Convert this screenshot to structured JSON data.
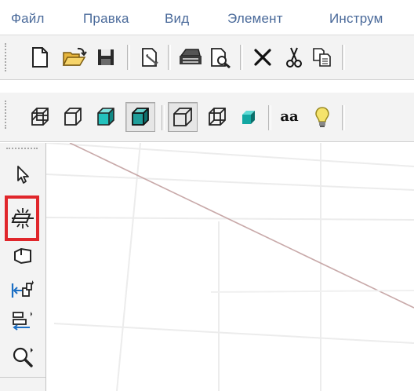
{
  "menu": {
    "items": [
      {
        "label": "Файл"
      },
      {
        "label": "Правка"
      },
      {
        "label": "Вид"
      },
      {
        "label": "Элемент"
      },
      {
        "label": "Инструм"
      }
    ]
  },
  "toolbar_main": {
    "buttons": [
      {
        "icon": "new-document-icon"
      },
      {
        "icon": "open-folder-icon"
      },
      {
        "icon": "save-icon"
      },
      {
        "icon": "properties-icon"
      },
      {
        "icon": "print-icon"
      },
      {
        "icon": "print-preview-icon"
      },
      {
        "icon": "delete-icon"
      },
      {
        "icon": "cut-icon"
      },
      {
        "icon": "copy-icon"
      }
    ]
  },
  "toolbar_view": {
    "buttons": [
      {
        "icon": "wireframe-icon",
        "pressed": false
      },
      {
        "icon": "hidden-lines-icon",
        "pressed": false
      },
      {
        "icon": "shaded-icon",
        "pressed": false
      },
      {
        "icon": "shaded-edges-icon",
        "pressed": true
      },
      {
        "icon": "perspective-icon",
        "pressed": true
      },
      {
        "icon": "wireframe-alt-icon",
        "pressed": false
      },
      {
        "icon": "solid-cube-icon",
        "pressed": false
      },
      {
        "icon": "font-size-icon",
        "label": "aa",
        "pressed": false
      },
      {
        "icon": "lightbulb-icon",
        "pressed": false
      }
    ]
  },
  "leftbar": {
    "buttons": [
      {
        "icon": "select-arrow-icon"
      },
      {
        "icon": "section-plane-icon",
        "highlighted": true
      },
      {
        "icon": "rotate-face-icon"
      },
      {
        "icon": "move-left-icon"
      },
      {
        "icon": "align-icon"
      },
      {
        "icon": "zoom-icon"
      }
    ]
  },
  "colors": {
    "menu_text": "#4a6a9a",
    "highlight": "#e0262b",
    "toolbar_bg": "#f3f3f3",
    "teal": "#1fb5b0"
  }
}
